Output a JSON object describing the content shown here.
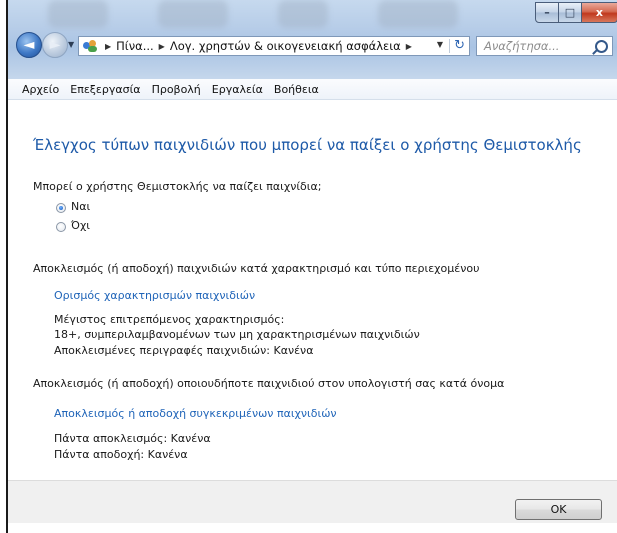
{
  "window": {
    "caption_buttons": {
      "minimize": "–",
      "maximize": "□",
      "close": "x"
    }
  },
  "nav": {
    "back_glyph": "◄",
    "forward_glyph": "►",
    "breadcrumbs": [
      "Πίνα...",
      "Λογ. χρηστών & οικογενειακή ασφάλεια"
    ],
    "breadcrumb_sep": "▶",
    "dropdown_glyph": "▼",
    "refresh_glyph": "↻",
    "search_placeholder": "Αναζήτησα..."
  },
  "menu": {
    "items": [
      "Αρχείο",
      "Επεξεργασία",
      "Προβολή",
      "Εργαλεία",
      "Βοήθεια"
    ]
  },
  "main": {
    "title": "Έλεγχος τύπων παιχνιδιών που μπορεί να παίξει ο χρήστης Θεμιστοκλής",
    "question": "Μπορεί ο χρήστης Θεμιστοκλής να παίζει παιχνίδια;",
    "options": [
      {
        "label": "Ναι",
        "checked": true
      },
      {
        "label": "Όχι",
        "checked": false
      }
    ],
    "section1": {
      "heading": "Αποκλεισμός (ή αποδοχή) παιχνιδιών κατά χαρακτηρισμό και τύπο περιεχομένου",
      "link": "Ορισμός χαρακτηρισμών παιχνιδιών",
      "lines": [
        "Μέγιστος επιτρεπόμενος χαρακτηρισμός:",
        "18+, συμπεριλαμβανομένων των μη χαρακτηρισμένων παιχνιδιών",
        "Αποκλεισμένες περιγραφές παιχνιδιών:  Κανένα"
      ]
    },
    "section2": {
      "heading": "Αποκλεισμός (ή αποδοχή) οποιουδήποτε παιχνιδιού στον υπολογιστή σας κατά όνομα",
      "link": "Αποκλεισμός ή αποδοχή συγκεκριμένων παιχνιδιών",
      "lines": [
        "Πάντα αποκλεισμός:  Κανένα",
        "Πάντα αποδοχή:  Κανένα"
      ]
    }
  },
  "footer": {
    "ok_label": "OK"
  },
  "colors": {
    "title_blue": "#1e5aa8",
    "link_blue": "#1f64b8",
    "chrome_blue": "#b7cde8"
  }
}
